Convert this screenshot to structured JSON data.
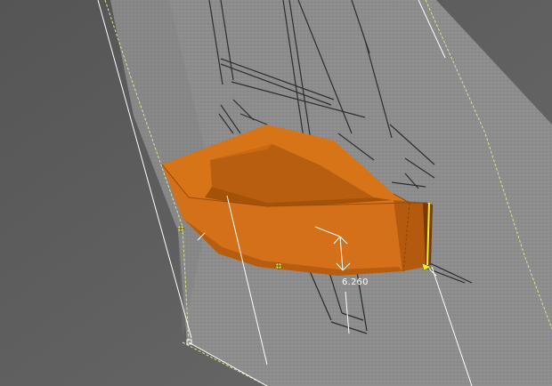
{
  "viewport": {
    "background": "#5c5c5c",
    "sketch_plane_color": "#8f8f8f",
    "plane_outline_color": "#e8e8a0",
    "hull_colors": {
      "light": "#e08a2a",
      "main": "#d07018",
      "dark": "#b85e10",
      "shadow": "#8a4508"
    }
  },
  "dimension": {
    "value": "6.260",
    "color": "#ffffff"
  },
  "icons": {
    "origin_marker_a": "workplane-origin-icon",
    "origin_marker_b": "workplane-origin-icon",
    "grip_point": "yellow-grip-icon"
  }
}
